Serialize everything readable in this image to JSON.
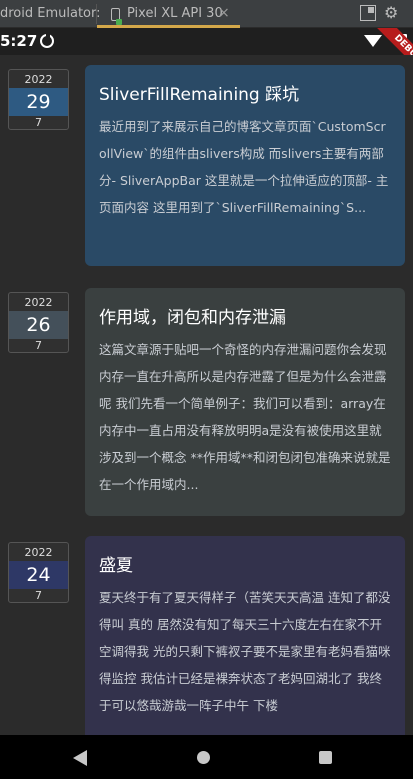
{
  "ide": {
    "emulator_label": "droid Emulator:",
    "tab_label": "Pixel XL API 30",
    "tab_close": "×"
  },
  "status": {
    "time": "5:27",
    "debug_label": "DEBUG"
  },
  "colors": {
    "card1": "#2a4a66",
    "card2": "#3a4040",
    "card3": "#33324c",
    "day1": "#2e5a82",
    "day2": "#44505a",
    "day3": "#2e3866"
  },
  "posts": [
    {
      "year": "2022",
      "day": "29",
      "month": "7",
      "title": "SliverFillRemaining 踩坑",
      "excerpt": "最近用到了来展示自己的博客文章页面`CustomScrollView`的组件由slivers构成 而slivers主要有两部分- SliverAppBar 这里就是一个拉伸适应的顶部- 主页面内容 这里用到了`SliverFillRemaining`S..."
    },
    {
      "year": "2022",
      "day": "26",
      "month": "7",
      "title": "作用域，闭包和内存泄漏",
      "excerpt": "这篇文章源于贴吧一个奇怪的内存泄漏问题你会发现内存一直在升高所以是内存泄露了但是为什么会泄露呢 我们先看一个简单例子：我们可以看到：array在内存中一直占用没有释放明明a是没有被使用这里就涉及到一个概念 **作用域**和闭包闭包准确来说就是在一个作用域内..."
    },
    {
      "year": "2022",
      "day": "24",
      "month": "7",
      "title": "盛夏",
      "excerpt": "夏天终于有了夏天得样子（苦笑天天高温 连知了都没得叫 真的 居然没有知了每天三十六度左右在家不开空调得我 光的只剩下裤衩子要不是家里有老妈看猫咪得监控 我估计已经是裸奔状态了老妈回湖北了 我终于可以悠哉游哉一阵子中午 下楼"
    }
  ]
}
